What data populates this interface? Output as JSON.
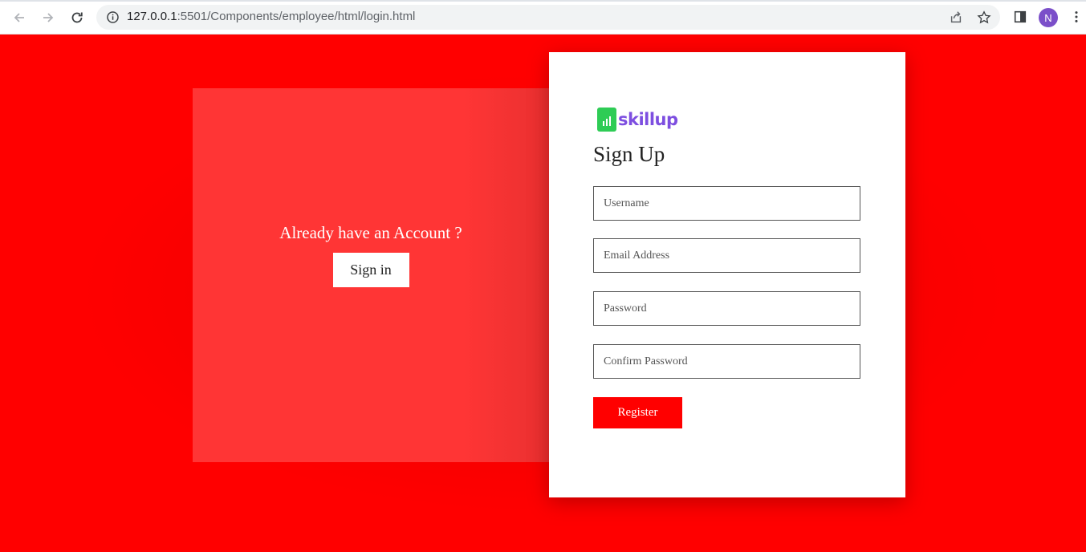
{
  "browser": {
    "url_host": "127.0.0.1",
    "url_path": ":5501/Components/employee/html/login.html",
    "avatar_initial": "N",
    "icons": [
      "back-arrow-icon",
      "forward-arrow-icon",
      "reload-icon",
      "info-icon",
      "share-icon",
      "star-icon",
      "side-panel-icon",
      "kebab-menu-icon"
    ]
  },
  "left_panel": {
    "prompt": "Already have an Account ?",
    "signin_label": "Sign in"
  },
  "form": {
    "logo_text": "skillup",
    "title": "Sign Up",
    "username_placeholder": "Username",
    "email_placeholder": "Email Address",
    "password_placeholder": "Password",
    "confirm_password_placeholder": "Confirm Password",
    "register_label": "Register"
  },
  "colors": {
    "background": "#ff0000",
    "left_panel": "#ff3535",
    "register_button": "#ff0000",
    "logo_green": "#2ecc55",
    "logo_purple": "#7d4ee0",
    "avatar": "#7b4fc9"
  }
}
